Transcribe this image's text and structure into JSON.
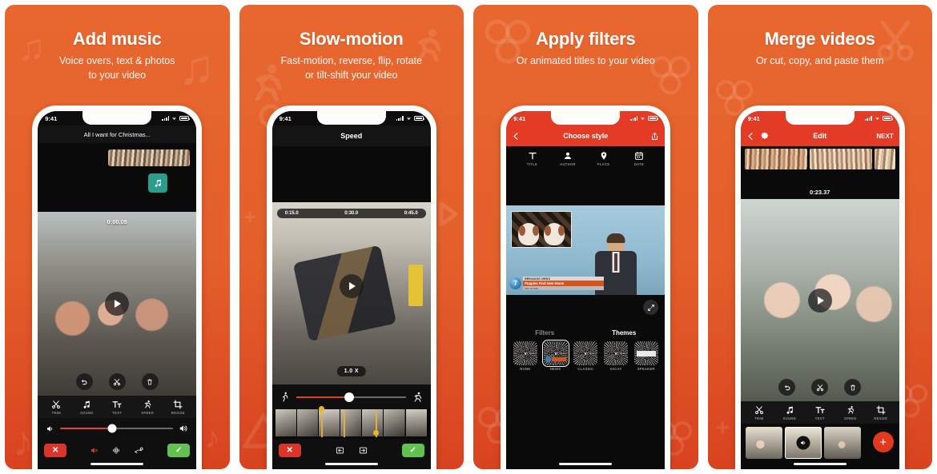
{
  "theme": {
    "orange": "#e8602c",
    "deep_red": "#d8431f",
    "accent_red": "#e33b26",
    "green": "#63c152",
    "teal": "#2a9d8f"
  },
  "panels": [
    {
      "id": "add-music",
      "title": "Add music",
      "subtitle": "Voice overs, text & photos\nto your video",
      "status_time": "9:41",
      "nav_title": "All I want for Christmas...",
      "nav_style": "dark",
      "timer": "0:00.05",
      "tools": [
        {
          "label": "TRIM",
          "icon": "scissors-icon"
        },
        {
          "label": "SOUND",
          "icon": "music-note-icon"
        },
        {
          "label": "TEXT",
          "icon": "text-icon"
        },
        {
          "label": "SPEED",
          "icon": "runner-icon"
        },
        {
          "label": "RESIZE",
          "icon": "crop-icon"
        }
      ],
      "round_buttons": [
        {
          "name": "undo-button",
          "icon": "undo-icon"
        },
        {
          "name": "cut-button",
          "icon": "scissors-icon"
        },
        {
          "name": "delete-button",
          "icon": "trash-icon"
        }
      ],
      "volume_low_icon": "volume-low-icon",
      "volume_high_icon": "volume-high-icon",
      "cancel_label": "✕",
      "confirm_label": "✓",
      "mid_icons": [
        "volume-mute-icon",
        "fade-icon",
        "voiceover-icon"
      ]
    },
    {
      "id": "slow-motion",
      "title": "Slow-motion",
      "subtitle": "Fast-motion, reverse, flip, rotate\nor tilt-shift your video",
      "status_time": "9:41",
      "nav_title": "Speed",
      "nav_style": "dark",
      "time_marks": [
        "0:15.0",
        "0:30.0",
        "0:45.0"
      ],
      "speed_badge": "1.0 X",
      "slider_left_icon": "walking-icon",
      "slider_right_icon": "running-icon",
      "cancel_label": "✕",
      "confirm_label": "✓",
      "mid_icons": [
        "trim-left-icon",
        "trim-right-icon"
      ]
    },
    {
      "id": "apply-filters",
      "title": "Apply filters",
      "subtitle": "Or animated titles to your video",
      "status_time": "9:41",
      "nav_title": "Choose style",
      "nav_style": "red",
      "back_icon": "back-chevron-icon",
      "share_icon": "share-icon",
      "style_tabs": [
        {
          "label": "TITLE",
          "icon": "title-t-icon"
        },
        {
          "label": "AUTHOR",
          "icon": "person-icon"
        },
        {
          "label": "PLACE",
          "icon": "location-pin-icon"
        },
        {
          "label": "DATE",
          "icon": "calendar-icon"
        }
      ],
      "expand_icon": "expand-icon",
      "bottom_tabs": [
        "Filters",
        "Themes"
      ],
      "selected_bottom_tab": "Themes",
      "filters": [
        {
          "label": "NONE",
          "selected": false
        },
        {
          "label": "NEWS",
          "selected": true
        },
        {
          "label": "CLASSIC",
          "selected": false
        },
        {
          "label": "VACAY",
          "selected": false
        },
        {
          "label": "SPEAKER",
          "selected": false
        }
      ],
      "ticker": {
        "kicker": "BREAKING NEWS",
        "headline": "Puppies Find New Home",
        "sub": "Mar 14 2024",
        "channel": "7"
      }
    },
    {
      "id": "merge-videos",
      "title": "Merge videos",
      "subtitle": "Or cut, copy, and paste them",
      "status_time": "9:41",
      "nav_title": "Edit",
      "nav_style": "red",
      "back_icon": "back-chevron-icon",
      "settings_icon": "gear-icon",
      "next_label": "NEXT",
      "timer": "0:23.37",
      "tools": [
        {
          "label": "TRIM",
          "icon": "scissors-icon"
        },
        {
          "label": "SOUND",
          "icon": "music-note-icon"
        },
        {
          "label": "TEXT",
          "icon": "text-icon"
        },
        {
          "label": "SPEED",
          "icon": "runner-icon"
        },
        {
          "label": "RESIZE",
          "icon": "crop-icon"
        }
      ],
      "round_buttons": [
        {
          "name": "undo-button",
          "icon": "undo-icon"
        },
        {
          "name": "cut-button",
          "icon": "scissors-icon"
        },
        {
          "name": "delete-button",
          "icon": "trash-icon"
        }
      ],
      "add_clip_label": "+",
      "clips_muted_icon": "volume-icon"
    }
  ]
}
